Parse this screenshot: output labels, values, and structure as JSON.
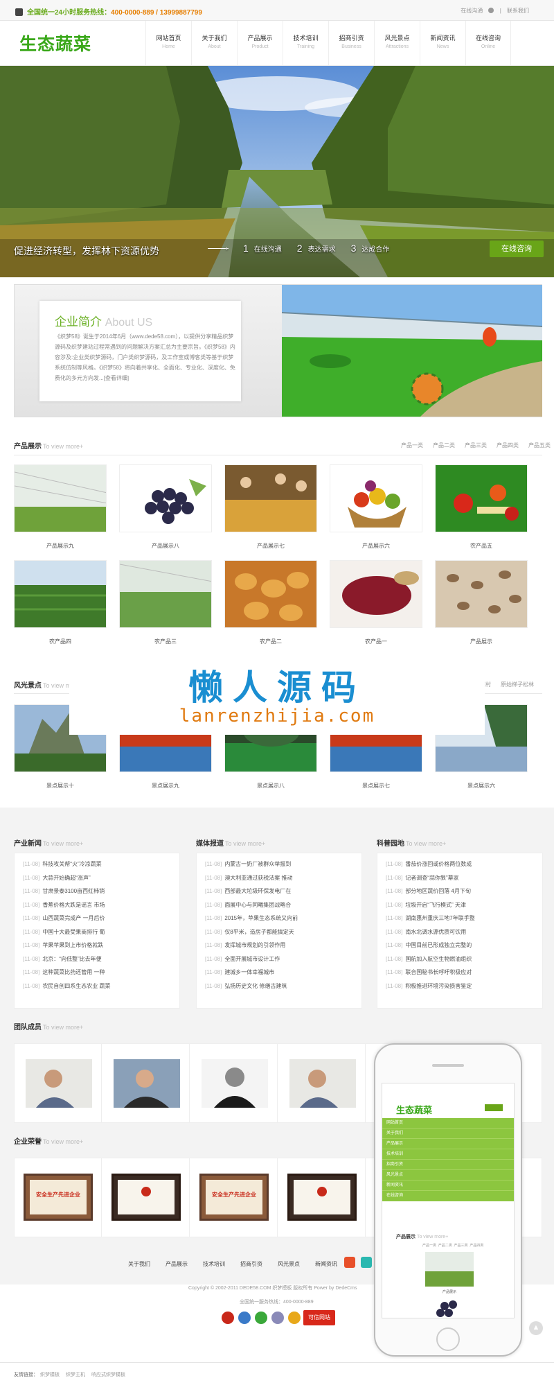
{
  "topbar": {
    "hotline_prefix": "全国统一24小时服务热线：",
    "hotline_numbers": "400-0000-889  /  13999887799",
    "online_consult": "在线沟通",
    "contact": "联系我们"
  },
  "logo": "生态蔬菜",
  "nav": [
    {
      "cn": "网站首页",
      "en": "Home"
    },
    {
      "cn": "关于我们",
      "en": "About"
    },
    {
      "cn": "产品展示",
      "en": "Product"
    },
    {
      "cn": "技术培训",
      "en": "Training"
    },
    {
      "cn": "招商引资",
      "en": "Business"
    },
    {
      "cn": "风光景点",
      "en": "Attractions"
    },
    {
      "cn": "新闻资讯",
      "en": "News"
    },
    {
      "cn": "在线咨询",
      "en": "Online"
    }
  ],
  "banner": {
    "slogan": "促进经济转型，发挥林下资源优势",
    "steps": [
      {
        "n": "1",
        "t": "在线沟通"
      },
      {
        "n": "2",
        "t": "表达需求"
      },
      {
        "n": "3",
        "t": "达成合作"
      }
    ],
    "consult_btn": "在线咨询"
  },
  "about": {
    "title": "企业简介",
    "title_en": "About US",
    "text": "《织梦58》诞生于2014年6月（www.dede58.com），以提供分享精品织梦源码及织梦建站过程常遇到的问题解决方案汇总为主要宗旨。《织梦58》内容涉及:企业类织梦源码，门户类织梦源码，及工作室或博客类等基于织梦系统仿制等风格。《织梦58》将向着共享化、全面化、专业化、深度化、免费化的多元方向发...[查看详细]"
  },
  "products": {
    "title": "产品展示",
    "more": "To view more+",
    "cats": [
      "产品一类",
      "产品二类",
      "产品三类",
      "产品四类",
      "产品五类"
    ],
    "items": [
      "产品展示九",
      "产品展示八",
      "产品展示七",
      "产品展示六",
      "农产品五",
      "农产品四",
      "农产品三",
      "农产品二",
      "农产品一",
      "产品展示"
    ]
  },
  "scenery": {
    "title": "风光景点",
    "more": "To view more+",
    "cats": [
      "度假村",
      "原始梯子松林"
    ],
    "items": [
      "景点展示十",
      "景点展示九",
      "景点展示八",
      "景点展示七",
      "景点展示六"
    ]
  },
  "watermark": {
    "cn": "懒人源码",
    "url": "lanrenzhijia.com"
  },
  "news": [
    {
      "title": "产业新闻",
      "more": "To view more+",
      "items": [
        {
          "d": "[11-08]",
          "t": "科技攻关帮“火”冷凉蔬菜"
        },
        {
          "d": "[11-08]",
          "t": "大蒜开始确超“涨声”"
        },
        {
          "d": "[11-08]",
          "t": "甘肃景泰3100亩西红柿销"
        },
        {
          "d": "[11-08]",
          "t": "香蕉价格大跌是谣言 市场"
        },
        {
          "d": "[11-08]",
          "t": "山西蔬菜完成产 一月后价"
        },
        {
          "d": "[11-08]",
          "t": "中国十大最受果商排行 葡"
        },
        {
          "d": "[11-08]",
          "t": "苹果苹果到上市价格就跌"
        },
        {
          "d": "[11-08]",
          "t": "北京：“向低整”比去年便"
        },
        {
          "d": "[11-08]",
          "t": "这种蔬菜比药还管用 一种"
        },
        {
          "d": "[11-08]",
          "t": "农民自创四系生态农业 蔬菜"
        }
      ]
    },
    {
      "title": "媒体报道",
      "more": "To view more+",
      "items": [
        {
          "d": "[11-08]",
          "t": "内蒙古一奶厂被群众举报到"
        },
        {
          "d": "[11-08]",
          "t": "澳大利亚通过获税法案 推动"
        },
        {
          "d": "[11-08]",
          "t": "西部最大垃圾环保发电厂在"
        },
        {
          "d": "[11-08]",
          "t": "面展中心与同曦集团战略合"
        },
        {
          "d": "[11-08]",
          "t": "2015年，苹果生态系统又向前"
        },
        {
          "d": "[11-08]",
          "t": "仅8平米，造房子都能搞定天"
        },
        {
          "d": "[11-08]",
          "t": "发挥城市规划的引领作用"
        },
        {
          "d": "[11-08]",
          "t": "全面开展城市设计工作"
        },
        {
          "d": "[11-08]",
          "t": "建城乡一体幸福城市"
        },
        {
          "d": "[11-08]",
          "t": "弘扬历史文化 修缮古建筑"
        }
      ]
    },
    {
      "title": "科普园地",
      "more": "To view more+",
      "items": [
        {
          "d": "[11-08]",
          "t": "番茄价涨回或价格两位数成"
        },
        {
          "d": "[11-08]",
          "t": "记者调查“蒜你狠”幕家"
        },
        {
          "d": "[11-08]",
          "t": "部分地区蔬价回落 4月下旬"
        },
        {
          "d": "[11-08]",
          "t": "垃圾开启“飞行模式” 天津"
        },
        {
          "d": "[11-08]",
          "t": "湖南惠州重庆三地7年联手整"
        },
        {
          "d": "[11-08]",
          "t": "南水北调水源优质可饮用"
        },
        {
          "d": "[11-08]",
          "t": "中国目前已形成独立完整的"
        },
        {
          "d": "[11-08]",
          "t": "国航加入航空生物燃油组织"
        },
        {
          "d": "[11-08]",
          "t": "联合国秘书长呼吁积极应对"
        },
        {
          "d": "[11-08]",
          "t": "积极推进环境污染损害鉴定"
        }
      ]
    }
  ],
  "team": {
    "title": "团队成员",
    "more": "To view more+"
  },
  "honor": {
    "title": "企业荣誉",
    "more": "To view more+",
    "cert_text": "安全生产先进企业"
  },
  "footer": {
    "links": [
      "关于我们",
      "产品展示",
      "技术培训",
      "招商引资",
      "风光景点",
      "新闻资讯"
    ],
    "copyright": "Copyright © 2002-2011 DEDE58.COM 织梦模板 版权所有 Power by DedeCms",
    "hotline": "全国统一服务热线：400-0000-889",
    "badge": "可信网站",
    "friend_label": "友情链接：",
    "friend_links": [
      "织梦模板",
      "织梦主机",
      "响应式织梦模板"
    ]
  },
  "mobile": {
    "logo": "生态蔬菜",
    "menu": [
      "网站首页",
      "关于我们",
      "产品展示",
      "技术培训",
      "招商引资",
      "风光景点",
      "新闻资讯",
      "在线咨询"
    ],
    "product_title": "产品展示",
    "product_more": "To view more+",
    "cats": "产品一类  产品二类  产品三类  产品四类",
    "caption": "产品展示"
  },
  "colors": {
    "accent": "#69a518",
    "brand": "#3aa81a",
    "orange": "#e67e00",
    "watermark_blue": "#1a8ed1"
  }
}
